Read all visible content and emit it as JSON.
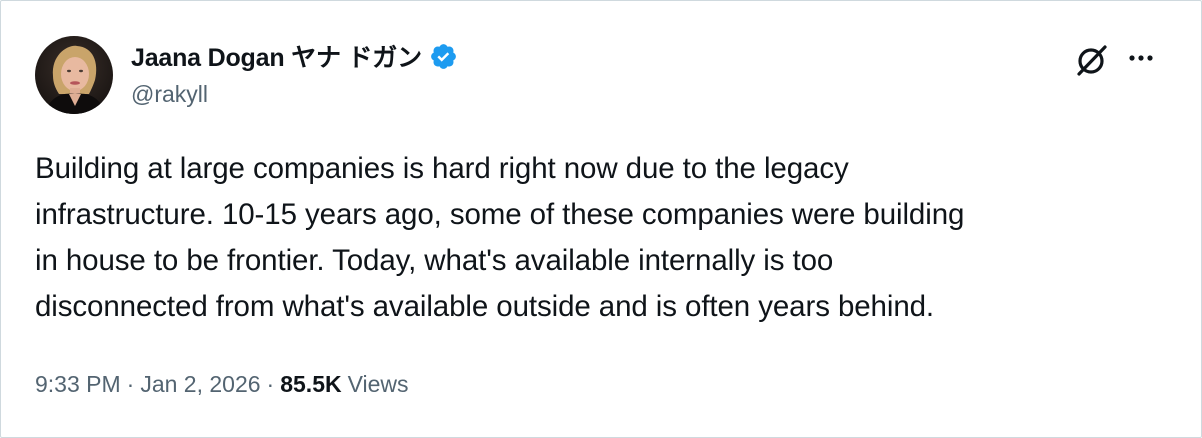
{
  "author": {
    "display_name": "Jaana Dogan ヤナ ドガン",
    "handle": "@rakyll",
    "avatar_icon": "profile-photo",
    "verified_icon": "verified-badge-icon",
    "verified_color": "#1d9bf0"
  },
  "actions": {
    "grok_icon": "grok-icon",
    "more_icon": "more-options-icon"
  },
  "tweet": {
    "lines": [
      "Building at large companies is hard right now due to the legacy",
      "infrastructure. 10-15 years ago, some of these companies were building",
      "in house to be frontier. Today, what's available internally is too",
      "disconnected from what's available outside and is often years behind."
    ]
  },
  "meta": {
    "time": "9:33 PM",
    "separator": "·",
    "date": "Jan 2, 2026",
    "views_count": "85.5K",
    "views_label": "Views"
  },
  "colors": {
    "text_primary": "#0f1419",
    "text_secondary": "#536471",
    "border": "#cfd9de",
    "brand_blue": "#1d9bf0"
  }
}
